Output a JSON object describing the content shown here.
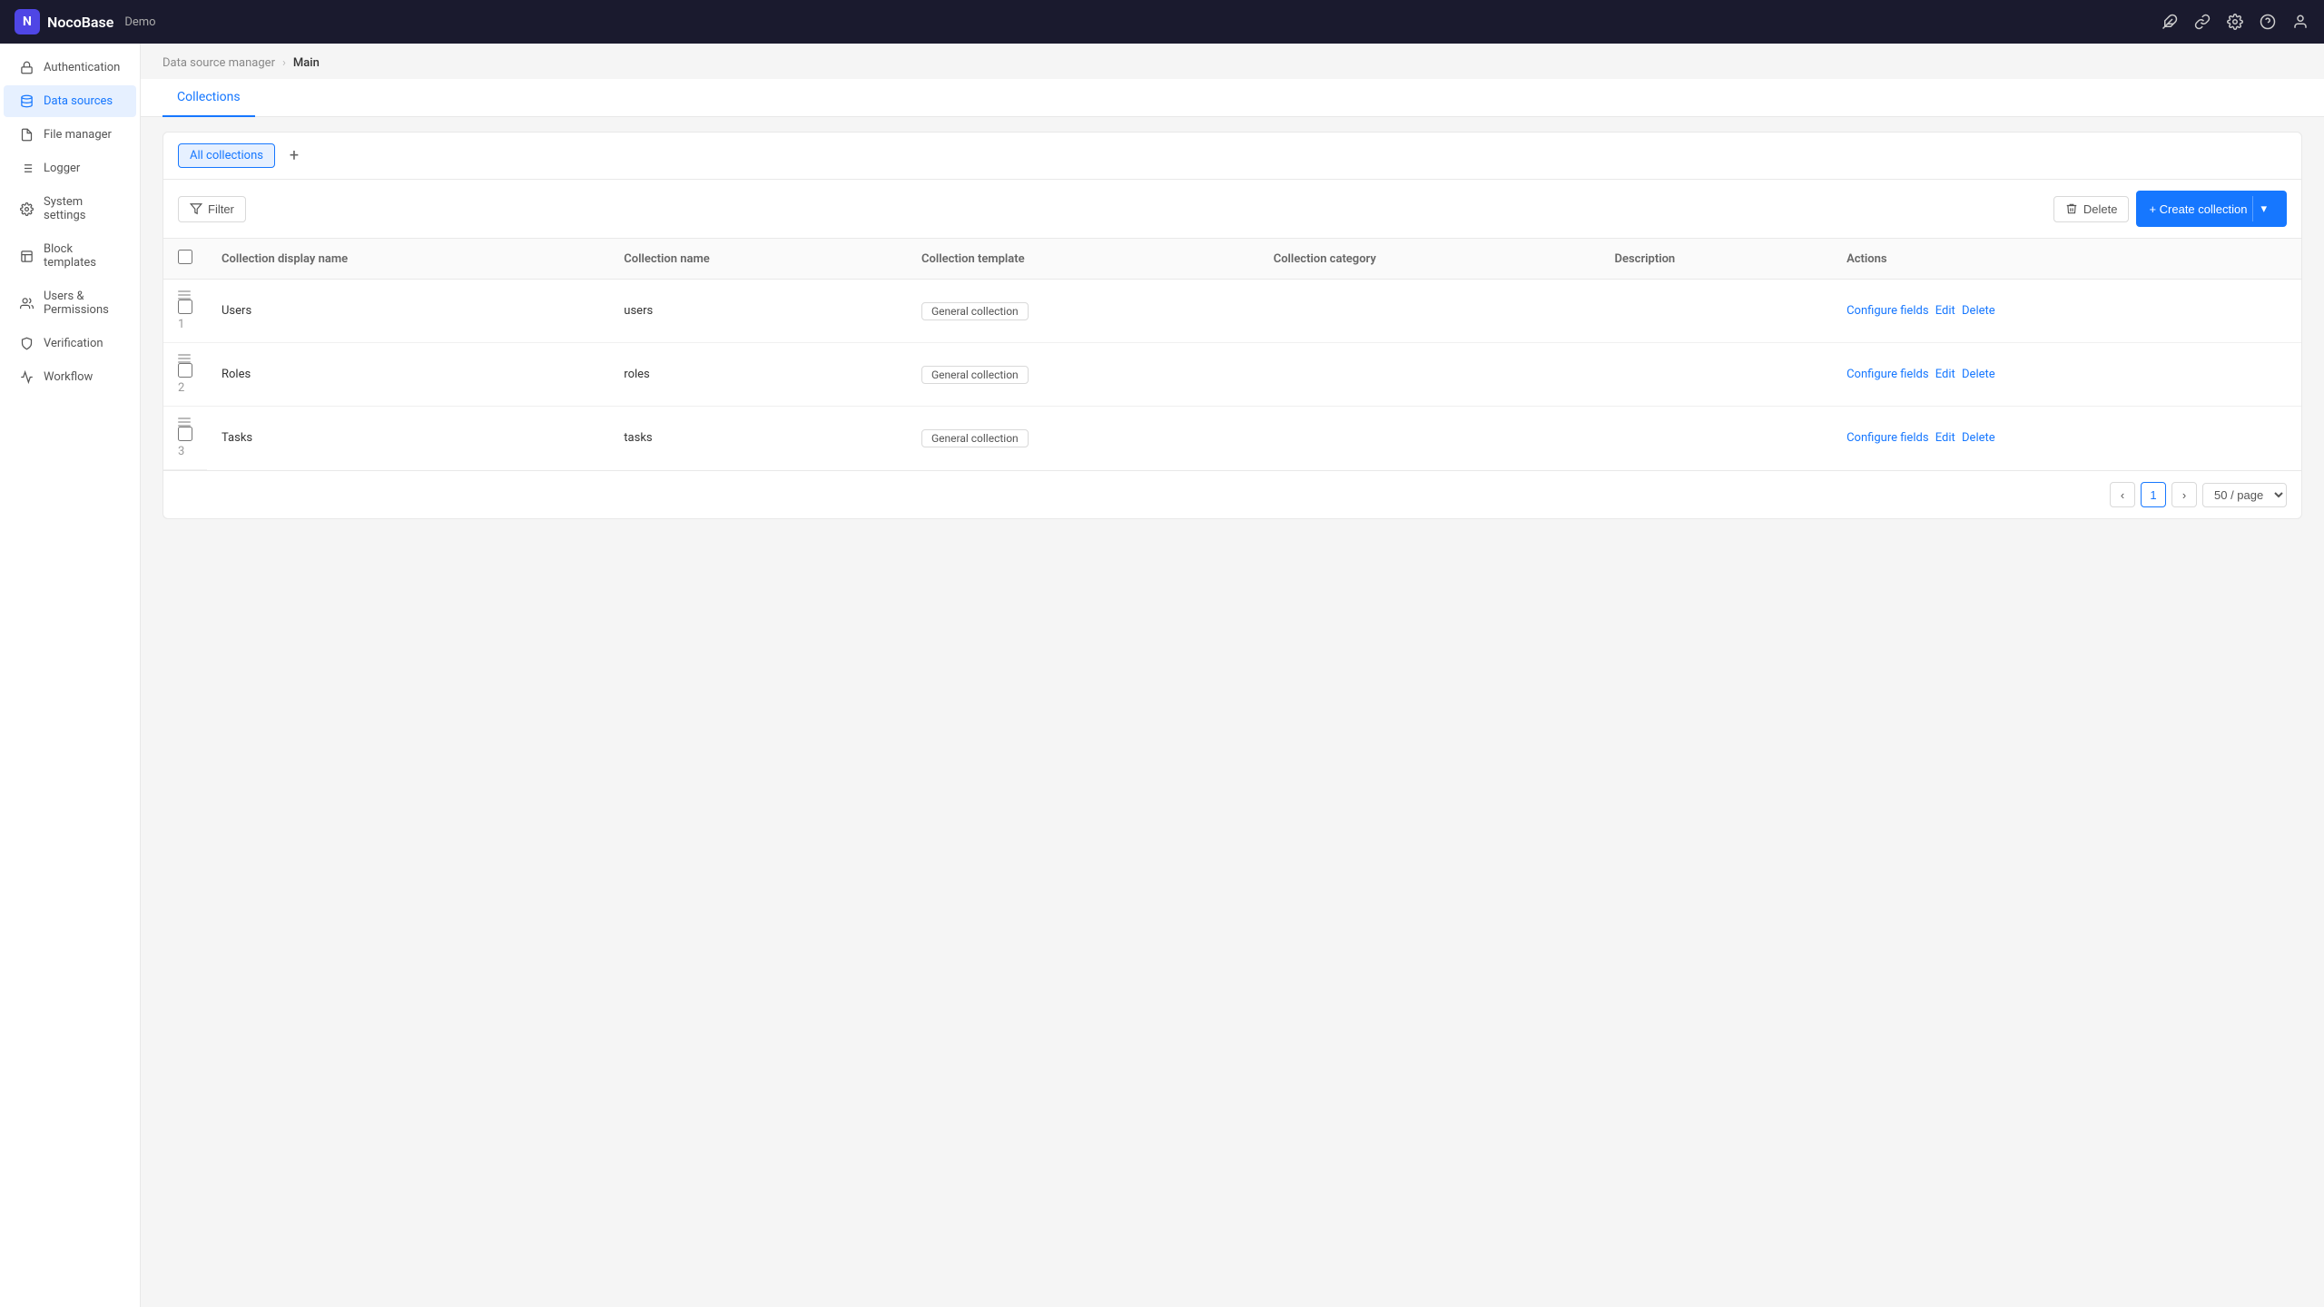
{
  "topbar": {
    "logo_text": "NocoBase",
    "demo_label": "Demo",
    "icons": [
      "plugin-icon",
      "link-icon",
      "settings-icon",
      "help-icon",
      "user-icon"
    ]
  },
  "sidebar": {
    "items": [
      {
        "id": "authentication",
        "label": "Authentication",
        "icon": "lock-icon",
        "active": false
      },
      {
        "id": "data-sources",
        "label": "Data sources",
        "icon": "database-icon",
        "active": true
      },
      {
        "id": "file-manager",
        "label": "File manager",
        "icon": "file-icon",
        "active": false
      },
      {
        "id": "logger",
        "label": "Logger",
        "icon": "list-icon",
        "active": false
      },
      {
        "id": "system-settings",
        "label": "System settings",
        "icon": "gear-icon",
        "active": false
      },
      {
        "id": "block-templates",
        "label": "Block templates",
        "icon": "template-icon",
        "active": false
      },
      {
        "id": "users-permissions",
        "label": "Users & Permissions",
        "icon": "users-icon",
        "active": false
      },
      {
        "id": "verification",
        "label": "Verification",
        "icon": "shield-icon",
        "active": false
      },
      {
        "id": "workflow",
        "label": "Workflow",
        "icon": "workflow-icon",
        "active": false
      }
    ]
  },
  "breadcrumb": {
    "parent": "Data source manager",
    "separator": "›",
    "current": "Main"
  },
  "tabs": [
    {
      "id": "collections",
      "label": "Collections",
      "active": true
    }
  ],
  "sub_tabs": [
    {
      "id": "all-collections",
      "label": "All collections",
      "active": true
    }
  ],
  "add_tab_label": "+",
  "toolbar": {
    "filter_label": "Filter",
    "delete_label": "Delete",
    "create_label": "+ Create collection"
  },
  "table": {
    "columns": [
      {
        "id": "col-display-name",
        "label": "Collection display name"
      },
      {
        "id": "col-name",
        "label": "Collection name"
      },
      {
        "id": "col-template",
        "label": "Collection template"
      },
      {
        "id": "col-category",
        "label": "Collection category"
      },
      {
        "id": "col-description",
        "label": "Description"
      },
      {
        "id": "col-actions",
        "label": "Actions"
      }
    ],
    "rows": [
      {
        "num": "1",
        "display_name": "Users",
        "name": "users",
        "template": "General collection",
        "category": "",
        "description": "",
        "actions": [
          "Configure fields",
          "Edit",
          "Delete"
        ]
      },
      {
        "num": "2",
        "display_name": "Roles",
        "name": "roles",
        "template": "General collection",
        "category": "",
        "description": "",
        "actions": [
          "Configure fields",
          "Edit",
          "Delete"
        ]
      },
      {
        "num": "3",
        "display_name": "Tasks",
        "name": "tasks",
        "template": "General collection",
        "category": "",
        "description": "",
        "actions": [
          "Configure fields",
          "Edit",
          "Delete"
        ]
      }
    ]
  },
  "pagination": {
    "prev_label": "‹",
    "next_label": "›",
    "current_page": "1",
    "page_size_label": "50 / page"
  }
}
